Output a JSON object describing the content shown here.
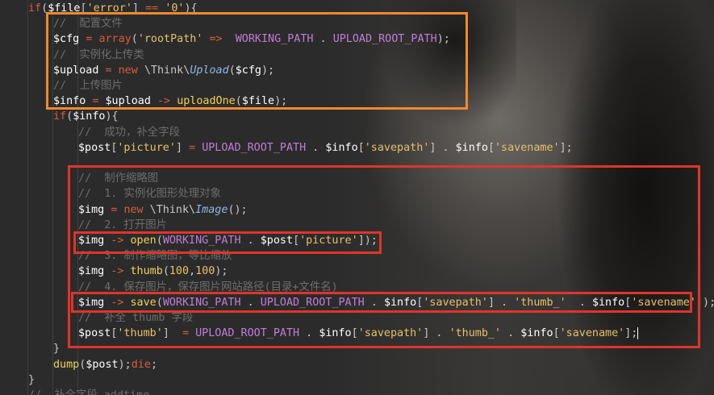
{
  "editor": {
    "lines": [
      {
        "indent": 1,
        "tokens": [
          [
            "kw",
            "if"
          ],
          [
            "p",
            "("
          ],
          [
            "var",
            "$file"
          ],
          [
            "p",
            "["
          ],
          [
            "str",
            "'error'"
          ],
          [
            "p",
            "] "
          ],
          [
            "op",
            "=="
          ],
          [
            "p",
            " "
          ],
          [
            "str",
            "'0'"
          ],
          [
            "p",
            "){"
          ]
        ]
      },
      {
        "indent": 2,
        "tokens": [
          [
            "cm",
            "//  配置文件"
          ]
        ]
      },
      {
        "indent": 2,
        "tokens": [
          [
            "var",
            "$cfg"
          ],
          [
            "p",
            " "
          ],
          [
            "op",
            "="
          ],
          [
            "p",
            " "
          ],
          [
            "kw",
            "array"
          ],
          [
            "p",
            "("
          ],
          [
            "str",
            "'rootPath'"
          ],
          [
            "p",
            " "
          ],
          [
            "op",
            "=>"
          ],
          [
            "p",
            "  "
          ],
          [
            "const",
            "WORKING_PATH"
          ],
          [
            "p",
            " . "
          ],
          [
            "const",
            "UPLOAD_ROOT_PATH"
          ],
          [
            "p",
            ");"
          ]
        ]
      },
      {
        "indent": 2,
        "tokens": [
          [
            "cm",
            "//  实例化上传类"
          ]
        ]
      },
      {
        "indent": 2,
        "tokens": [
          [
            "var",
            "$upload"
          ],
          [
            "p",
            " "
          ],
          [
            "op",
            "="
          ],
          [
            "p",
            " "
          ],
          [
            "kw",
            "new"
          ],
          [
            "p",
            " \\Think\\"
          ],
          [
            "clsit",
            "Upload"
          ],
          [
            "p",
            "("
          ],
          [
            "var",
            "$cfg"
          ],
          [
            "p",
            ");"
          ]
        ]
      },
      {
        "indent": 2,
        "tokens": [
          [
            "cm",
            "//  上传图片"
          ]
        ]
      },
      {
        "indent": 2,
        "tokens": [
          [
            "var",
            "$info"
          ],
          [
            "p",
            " "
          ],
          [
            "op",
            "="
          ],
          [
            "p",
            " "
          ],
          [
            "var",
            "$upload"
          ],
          [
            "p",
            " "
          ],
          [
            "op",
            "->"
          ],
          [
            "p",
            " "
          ],
          [
            "fn",
            "uploadOne"
          ],
          [
            "p",
            "("
          ],
          [
            "var",
            "$file"
          ],
          [
            "p",
            ");"
          ]
        ]
      },
      {
        "indent": 2,
        "tokens": [
          [
            "kw",
            "if"
          ],
          [
            "p",
            "("
          ],
          [
            "var",
            "$info"
          ],
          [
            "p",
            "){"
          ]
        ]
      },
      {
        "indent": 3,
        "tokens": [
          [
            "cm",
            "//  成功，补全字段"
          ]
        ]
      },
      {
        "indent": 3,
        "tokens": [
          [
            "var",
            "$post"
          ],
          [
            "p",
            "["
          ],
          [
            "str",
            "'picture'"
          ],
          [
            "p",
            "] "
          ],
          [
            "op",
            "="
          ],
          [
            "p",
            " "
          ],
          [
            "const",
            "UPLOAD_ROOT_PATH"
          ],
          [
            "p",
            " . "
          ],
          [
            "var",
            "$info"
          ],
          [
            "p",
            "["
          ],
          [
            "str",
            "'savepath'"
          ],
          [
            "p",
            "] . "
          ],
          [
            "var",
            "$info"
          ],
          [
            "p",
            "["
          ],
          [
            "str",
            "'savename'"
          ],
          [
            "p",
            "];"
          ]
        ]
      },
      {
        "indent": 3,
        "tokens": []
      },
      {
        "indent": 3,
        "tokens": [
          [
            "cm",
            "//  制作缩略图"
          ]
        ]
      },
      {
        "indent": 3,
        "tokens": [
          [
            "cm",
            "//  1. 实例化图形处理对象"
          ]
        ]
      },
      {
        "indent": 3,
        "tokens": [
          [
            "var",
            "$img"
          ],
          [
            "p",
            " "
          ],
          [
            "op",
            "="
          ],
          [
            "p",
            " "
          ],
          [
            "kw",
            "new"
          ],
          [
            "p",
            " \\Think\\"
          ],
          [
            "clsit",
            "Image"
          ],
          [
            "p",
            "();"
          ]
        ]
      },
      {
        "indent": 3,
        "tokens": [
          [
            "cm",
            "//  2. 打开图片"
          ]
        ]
      },
      {
        "indent": 3,
        "tokens": [
          [
            "var",
            "$img"
          ],
          [
            "p",
            " "
          ],
          [
            "op",
            "->"
          ],
          [
            "p",
            " "
          ],
          [
            "fn",
            "open"
          ],
          [
            "p",
            "("
          ],
          [
            "const",
            "WORKING_PATH"
          ],
          [
            "p",
            " . "
          ],
          [
            "var",
            "$post"
          ],
          [
            "p",
            "["
          ],
          [
            "str",
            "'picture'"
          ],
          [
            "p",
            "]);"
          ]
        ]
      },
      {
        "indent": 3,
        "tokens": [
          [
            "cm",
            "//  3. 制作缩略图，等比缩放"
          ]
        ]
      },
      {
        "indent": 3,
        "tokens": [
          [
            "var",
            "$img"
          ],
          [
            "p",
            " "
          ],
          [
            "op",
            "->"
          ],
          [
            "p",
            " "
          ],
          [
            "fn",
            "thumb"
          ],
          [
            "p",
            "("
          ],
          [
            "num",
            "100"
          ],
          [
            "p",
            ","
          ],
          [
            "num",
            "100"
          ],
          [
            "p",
            ");"
          ]
        ]
      },
      {
        "indent": 3,
        "tokens": [
          [
            "cm",
            "//  4. 保存图片，保存图片网站路径(目录+文件名)"
          ]
        ]
      },
      {
        "indent": 3,
        "tokens": [
          [
            "var",
            "$img"
          ],
          [
            "p",
            " "
          ],
          [
            "op",
            "->"
          ],
          [
            "p",
            " "
          ],
          [
            "fn",
            "save"
          ],
          [
            "p",
            "("
          ],
          [
            "const",
            "WORKING_PATH"
          ],
          [
            "p",
            " . "
          ],
          [
            "const",
            "UPLOAD_ROOT_PATH"
          ],
          [
            "p",
            " . "
          ],
          [
            "var",
            "$info"
          ],
          [
            "p",
            "["
          ],
          [
            "str",
            "'savepath'"
          ],
          [
            "p",
            "] . "
          ],
          [
            "str",
            "'thumb_'"
          ],
          [
            "p",
            "  . "
          ],
          [
            "var",
            "$info"
          ],
          [
            "p",
            "["
          ],
          [
            "str",
            "'savename'"
          ],
          [
            "p",
            "]);"
          ]
        ]
      },
      {
        "indent": 3,
        "tokens": [
          [
            "cm",
            "//  补全 thumb 字段"
          ]
        ]
      },
      {
        "indent": 3,
        "tokens": [
          [
            "var",
            "$post"
          ],
          [
            "p",
            "["
          ],
          [
            "str",
            "'thumb'"
          ],
          [
            "p",
            "]  "
          ],
          [
            "op",
            "="
          ],
          [
            "p",
            " "
          ],
          [
            "const",
            "UPLOAD_ROOT_PATH"
          ],
          [
            "p",
            " . "
          ],
          [
            "var",
            "$info"
          ],
          [
            "p",
            "["
          ],
          [
            "str",
            "'savepath'"
          ],
          [
            "p",
            "] . "
          ],
          [
            "str",
            "'thumb_'"
          ],
          [
            "p",
            " . "
          ],
          [
            "var",
            "$info"
          ],
          [
            "p",
            "["
          ],
          [
            "str",
            "'savename'"
          ],
          [
            "p",
            "];"
          ],
          [
            "cursor",
            ""
          ]
        ]
      },
      {
        "indent": 2,
        "tokens": [
          [
            "p",
            "}"
          ]
        ]
      },
      {
        "indent": 2,
        "tokens": [
          [
            "fn",
            "dump"
          ],
          [
            "p",
            "("
          ],
          [
            "var",
            "$post"
          ],
          [
            "p",
            ");"
          ],
          [
            "kw",
            "die"
          ],
          [
            "p",
            ";"
          ]
        ]
      },
      {
        "indent": 1,
        "tokens": [
          [
            "p",
            "}"
          ]
        ]
      },
      {
        "indent": 1,
        "tokens": [
          [
            "cm",
            "//  补全字段 addtime"
          ]
        ]
      }
    ]
  },
  "highlights": {
    "orange": "#f0892f",
    "red": "#e0342a"
  }
}
